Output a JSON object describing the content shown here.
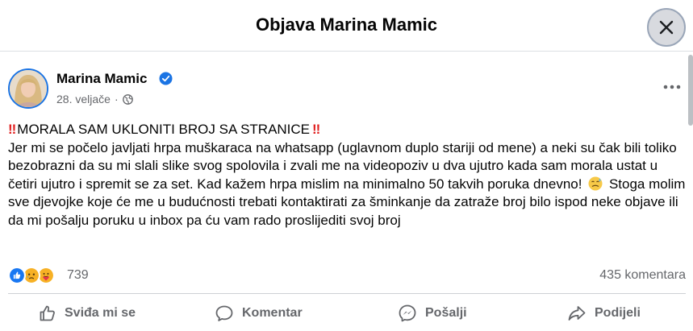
{
  "header": {
    "title": "Objava Marina Mamic"
  },
  "post": {
    "author": "Marina Mamic",
    "date": "28. veljače",
    "separator": "·",
    "headline": "MORALA SAM UKLONITI BROJ SA STRANICE",
    "body_1": "Jer mi se počelo javljati hrpa muškaraca na whatsapp (uglavnom duplo stariji od mene) a neki su čak bili toliko bezobrazni da su mi slali slike svog spolovila i zvali me na videopoziv u dva ujutro kada sam morala ustat u četiri ujutro i spremit se za set. Kad kažem hrpa mislim na minimalno 50 takvih poruka dnevno!",
    "body_2": "Stoga molim sve djevojke koje će me u budućnosti trebati kontaktirati za šminkanje da zatraže broj bilo ispod neke objave ili da mi pošalju poruku u inbox pa ću vam rado proslijediti svoj broj",
    "warn_glyph": "‼",
    "reaction_count": "739",
    "comment_count": "435 komentara"
  },
  "actions": {
    "like": "Sviđa mi se",
    "comment": "Komentar",
    "send": "Pošalji",
    "share": "Podijeli"
  },
  "colors": {
    "accent": "#1b74e4",
    "text_secondary": "#65676b",
    "warn": "#e02020"
  },
  "icons": [
    "close-icon",
    "verified-icon",
    "globe-icon",
    "more-icon",
    "like-reaction-icon",
    "sad-reaction-icon",
    "care-reaction-icon",
    "like-icon",
    "comment-icon",
    "messenger-icon",
    "share-icon"
  ]
}
